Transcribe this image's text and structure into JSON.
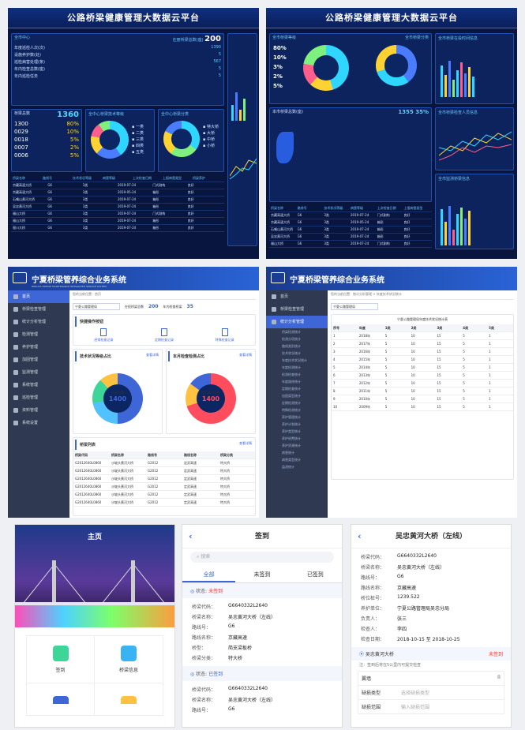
{
  "dash1": {
    "title": "公路桥梁健康管理大数据云平台",
    "center": "全市中心",
    "bridge_total_label": "在册桥梁总数(座)",
    "bridge_total": "200",
    "total_label": "桥梁总数",
    "total": "1360",
    "stats": [
      [
        "1300",
        "80%"
      ],
      [
        "0029",
        "10%"
      ],
      [
        "0018",
        "5%"
      ],
      [
        "0007",
        "2%"
      ],
      [
        "0006",
        "5%"
      ]
    ],
    "left_rows": [
      [
        "年度巡检人次(次)",
        "1390"
      ],
      [
        "设施养护数(处)",
        "5"
      ],
      [
        "巡检病害处理(条)",
        "567"
      ],
      [
        "年内检查总数(座)",
        "5"
      ],
      [
        "年内巡检任务",
        "5"
      ]
    ],
    "panel_a": "全中心桥梁技术等级",
    "panel_b": "全中心桥梁分类",
    "legend_a": [
      "一类",
      "二类",
      "三类",
      "四类",
      "五类"
    ],
    "legend_b": [
      "特大桥",
      "大桥",
      "中桥",
      "小桥"
    ],
    "table_head": [
      "桥梁名称",
      "路线号",
      "技术状况等级",
      "病害等级",
      "上次检查日期",
      "上报病害类型",
      "桥梁养护"
    ],
    "table_rows": [
      [
        "京藏高速大桥",
        "G6",
        "3类",
        "2019-07-24",
        "门式刚构",
        "良好"
      ],
      [
        "京藏高速大桥",
        "G6",
        "3类",
        "2019-05-24",
        "箱形",
        "良好"
      ],
      [
        "石嘴山黄河大桥",
        "G6",
        "3类",
        "2019-07-24",
        "箱形",
        "良好"
      ],
      [
        "吴忠黄河大桥",
        "G6",
        "3类",
        "2019-07-24",
        "箱形",
        "良好"
      ],
      [
        "福山大桥",
        "G6",
        "3类",
        "2019-07-24",
        "门式刚构",
        "良好"
      ],
      [
        "福山大桥",
        "G6",
        "3类",
        "2019-07-24",
        "箱形",
        "良好"
      ],
      [
        "银川大桥",
        "G6",
        "3类",
        "2019-07-24",
        "箱形",
        "良好"
      ]
    ]
  },
  "dash2": {
    "title": "公路桥梁健康管理大数据云平台",
    "panel_a": "全市桥梁等级",
    "panel_b": "全市桥梁分类",
    "pcts": [
      "80%",
      "10%",
      "3%",
      "2%",
      "5%"
    ],
    "mid_label": "本市桥梁总数(座)",
    "mid_value": "1355 35%",
    "right_a": "全市桥梁在役时间信息",
    "right_b": "全市桥梁检查人员信息",
    "right_c": "全市监测桥梁信息"
  },
  "admin1": {
    "title": "宁夏桥梁管养综合业务系统",
    "subtitle": "NINGXIA BRIDGE MAINTENANCE INTEGRATED SERVICE SYSTEM",
    "menu": [
      "首页",
      "桥梁检查管理",
      "统计分析管理",
      "检测管理",
      "养护管理",
      "加固管理",
      "监测管理",
      "系统管理",
      "巡检管理",
      "资料管理",
      "系统设置"
    ],
    "crumb": "您的当前位置：首页",
    "select": "宁夏公路管理局",
    "bridge_count_label": "在役桥梁总数",
    "bridge_count": "200",
    "inspect_label": "年内检查桥梁",
    "inspect": "35",
    "quick": "快捷操作按钮",
    "quick_items": [
      "经常检查记录",
      "定期检查记录",
      "特殊检查记录"
    ],
    "chart_a": "技术状况等级占比",
    "chart_b": "本月检查检测占比",
    "more": "查看详情",
    "center_a_label": "桥梁总数",
    "center_a": "1400",
    "center_b_label": "定检查桥梁数",
    "center_b": "1400",
    "list_title": "桥梁列表",
    "list_more": "查看详情",
    "list_head": [
      "桥梁代码",
      "桥梁名称",
      "路线号",
      "路线名称",
      "桥梁分类"
    ],
    "list_rows": [
      [
        "G2012640L0860",
        "沙坡头黄河大桥",
        "G2012",
        "定武高速",
        "特大桥"
      ],
      [
        "G2012640L0860",
        "沙坡头黄河大桥",
        "G2012",
        "定武高速",
        "特大桥"
      ],
      [
        "G2012640L0860",
        "沙坡头黄河大桥",
        "G2012",
        "定武高速",
        "特大桥"
      ],
      [
        "G2012640L0860",
        "沙坡头黄河大桥",
        "G2012",
        "定武高速",
        "特大桥"
      ],
      [
        "G2012640L0860",
        "沙坡头黄河大桥",
        "G2012",
        "定武高速",
        "特大桥"
      ],
      [
        "G2012640L0860",
        "沙坡头黄河大桥",
        "G2012",
        "定武高速",
        "特大桥"
      ]
    ]
  },
  "admin2": {
    "title": "宁夏桥梁管养综合业务系统",
    "crumb": "您的当前位置：统计分析管理 > 年度技术状况统计",
    "select": "宁夏公路管理局",
    "table_title": "宁夏公路管理局年度技术状况统计表",
    "menu": [
      "首页",
      "桥梁检查管理",
      "统计分析管理"
    ],
    "sub": [
      "桥梁检测统计",
      "检测分项统计",
      "路线类别统计",
      "技术状况统计",
      "年度技术状况统计",
      "年度检测统计",
      "检测检查统计",
      "年度维修统计",
      "定期检查统计",
      "加固类型统计",
      "定期检测统计",
      "特殊检测统计",
      "养护管理统计",
      "养护计划统计",
      "养护类型统计",
      "养护经费统计",
      "养护资源统计",
      "病害统计",
      "病害类型统计",
      "监测统计"
    ],
    "head": [
      "序号",
      "年度",
      "1类",
      "2类",
      "3类",
      "4类",
      "5类"
    ],
    "years": [
      "2018年",
      "2017年",
      "2016年",
      "2015年",
      "2014年",
      "2013年",
      "2012年",
      "2011年",
      "2010年",
      "2009年"
    ]
  },
  "mob1": {
    "title": "主页",
    "items": [
      "签到",
      "桥梁信息"
    ]
  },
  "mob2": {
    "title": "签到",
    "search": "搜索",
    "tabs": [
      "全部",
      "未签到",
      "已签到"
    ],
    "status_label": "状态:",
    "status_a": "未签到",
    "status_b": "已签到",
    "fields": [
      [
        "桥梁代码：",
        "G6640332L2640"
      ],
      [
        "桥梁名称：",
        "吴忠黄河大桥（左线）"
      ],
      [
        "路线号：",
        "G6"
      ],
      [
        "路线名称：",
        "京藏高速"
      ],
      [
        "桥型：",
        "简支梁板桥"
      ],
      [
        "桥梁分类：",
        "特大桥"
      ]
    ],
    "fields_b": [
      [
        "桥梁代码：",
        "G6640332L2640"
      ],
      [
        "桥梁名称：",
        "吴忠黄河大桥（左线）"
      ],
      [
        "路线号：",
        "G6"
      ]
    ]
  },
  "mob3": {
    "title": "吴忠黄河大桥（左线）",
    "fields": [
      [
        "桥梁代码：",
        "G6640332L2640"
      ],
      [
        "桥梁名称：",
        "吴忠黄河大桥（左线）"
      ],
      [
        "路线号：",
        "G6"
      ],
      [
        "路线名称：",
        "京藏高速"
      ],
      [
        "桥位桩号：",
        "1239.522"
      ],
      [
        "养护单位：",
        "宁夏公路管理局吴忠分局"
      ],
      [
        "负责人：",
        "张三"
      ],
      [
        "检查人：",
        "李四"
      ],
      [
        "检查日期：",
        "2018-10-15 至 2018-10-25"
      ]
    ],
    "bridge": "吴忠黄河大桥",
    "status": "未签到",
    "note": "注：签到后将在5公里内可提交检查",
    "section": "翼墙",
    "rows": [
      [
        "缺损类型",
        "选择缺损类型"
      ],
      [
        "缺损范围",
        "输入缺损范围"
      ]
    ]
  }
}
